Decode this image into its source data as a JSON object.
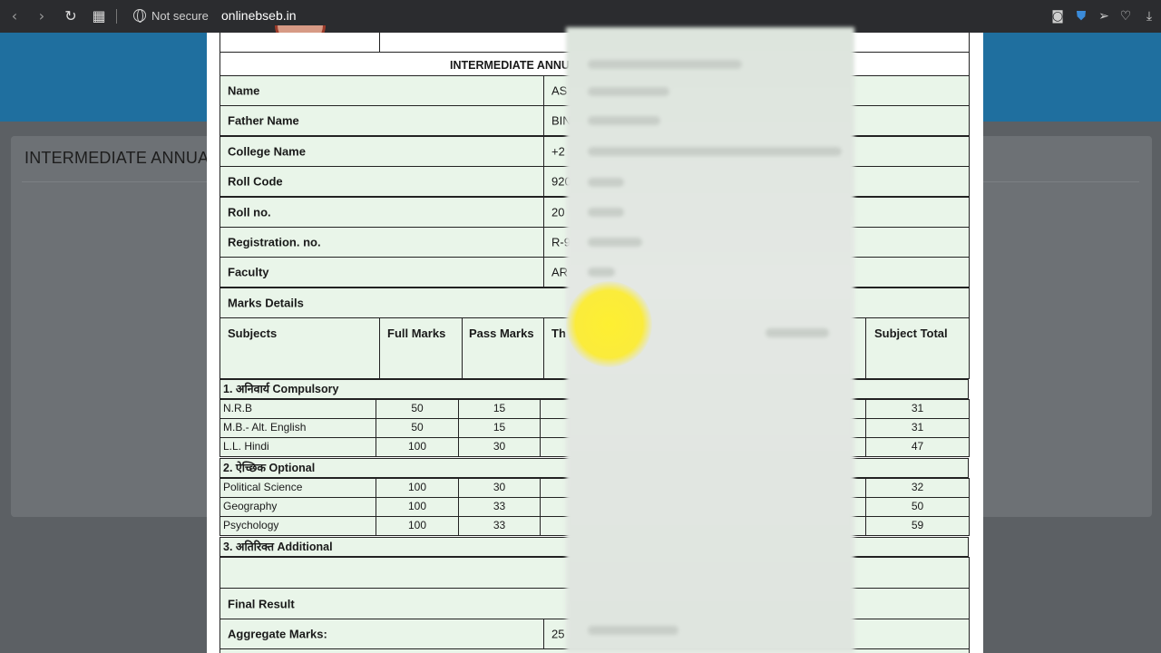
{
  "browser": {
    "security_label": "Not secure",
    "url": "onlinebseb.in",
    "icons": [
      "back-icon",
      "forward-icon",
      "reload-icon",
      "tabs-grid-icon",
      "camera-icon",
      "shield-icon",
      "send-icon",
      "heart-icon",
      "download-icon"
    ]
  },
  "background": {
    "title": "INTERMEDIATE ANNUA"
  },
  "document": {
    "heading": "INTERMEDIATE ANNU",
    "fields": [
      {
        "label": "Name",
        "value": "AS"
      },
      {
        "label": "Father Name",
        "value": "BIN"
      },
      {
        "label": "College Name",
        "value": "+2"
      },
      {
        "label": "Roll Code",
        "value": "920"
      },
      {
        "label": "Roll no.",
        "value": "20"
      },
      {
        "label": "Registration. no.",
        "value": "R-9"
      },
      {
        "label": "Faculty",
        "value": "AR"
      }
    ],
    "marks_details_label": "Marks Details",
    "columns": {
      "subjects": "Subjects",
      "full_marks": "Full Marks",
      "pass_marks": "Pass Marks",
      "theory": "Th",
      "subject_total": "Subject Total"
    },
    "sections": [
      {
        "title": "1. अनिवार्य Compulsory",
        "rows": [
          {
            "subject": "N.R.B",
            "full": "50",
            "pass": "15",
            "total": "31"
          },
          {
            "subject": "M.B.- Alt. English",
            "full": "50",
            "pass": "15",
            "total": "31"
          },
          {
            "subject": "L.L. Hindi",
            "full": "100",
            "pass": "30",
            "total": "47"
          }
        ]
      },
      {
        "title": "2. ऐच्छिक Optional",
        "rows": [
          {
            "subject": "Political Science",
            "full": "100",
            "pass": "30",
            "total": "32"
          },
          {
            "subject": "Geography",
            "full": "100",
            "pass": "33",
            "total": "50"
          },
          {
            "subject": "Psychology",
            "full": "100",
            "pass": "33",
            "total": "59"
          }
        ]
      },
      {
        "title": "3. अतिरिक्त Additional",
        "rows": []
      }
    ],
    "final_result_label": "Final Result",
    "aggregate_label": "Aggregate Marks:",
    "aggregate_value": "25"
  },
  "colors": {
    "cell_bg": "#e9f5e9",
    "banner": "#1f6f9f",
    "highlight": "#ffec1e"
  }
}
